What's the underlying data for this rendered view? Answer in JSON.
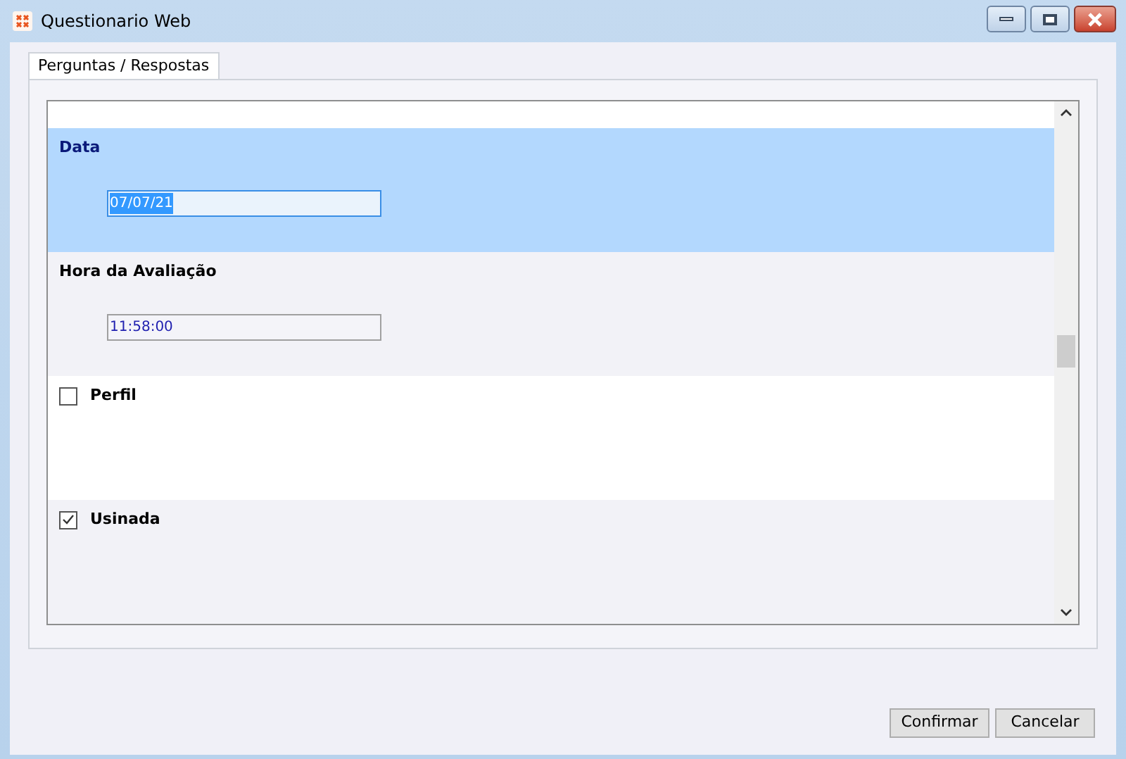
{
  "window": {
    "title": "Questionario Web"
  },
  "tabs": [
    {
      "label": "Perguntas / Respostas",
      "selected": true
    }
  ],
  "questions": [
    {
      "kind": "field",
      "label": "Data",
      "value": "07/07/21",
      "selected": true
    },
    {
      "kind": "field",
      "label": "Hora da Avaliação",
      "value": "11:58:00",
      "selected": false
    },
    {
      "kind": "checkbox",
      "label": "Perfil",
      "checked": false,
      "selected": false
    },
    {
      "kind": "checkbox",
      "label": "Usinada",
      "checked": true,
      "selected": false
    }
  ],
  "buttons": [
    {
      "label": "Confirmar"
    },
    {
      "label": "Cancelar"
    }
  ]
}
